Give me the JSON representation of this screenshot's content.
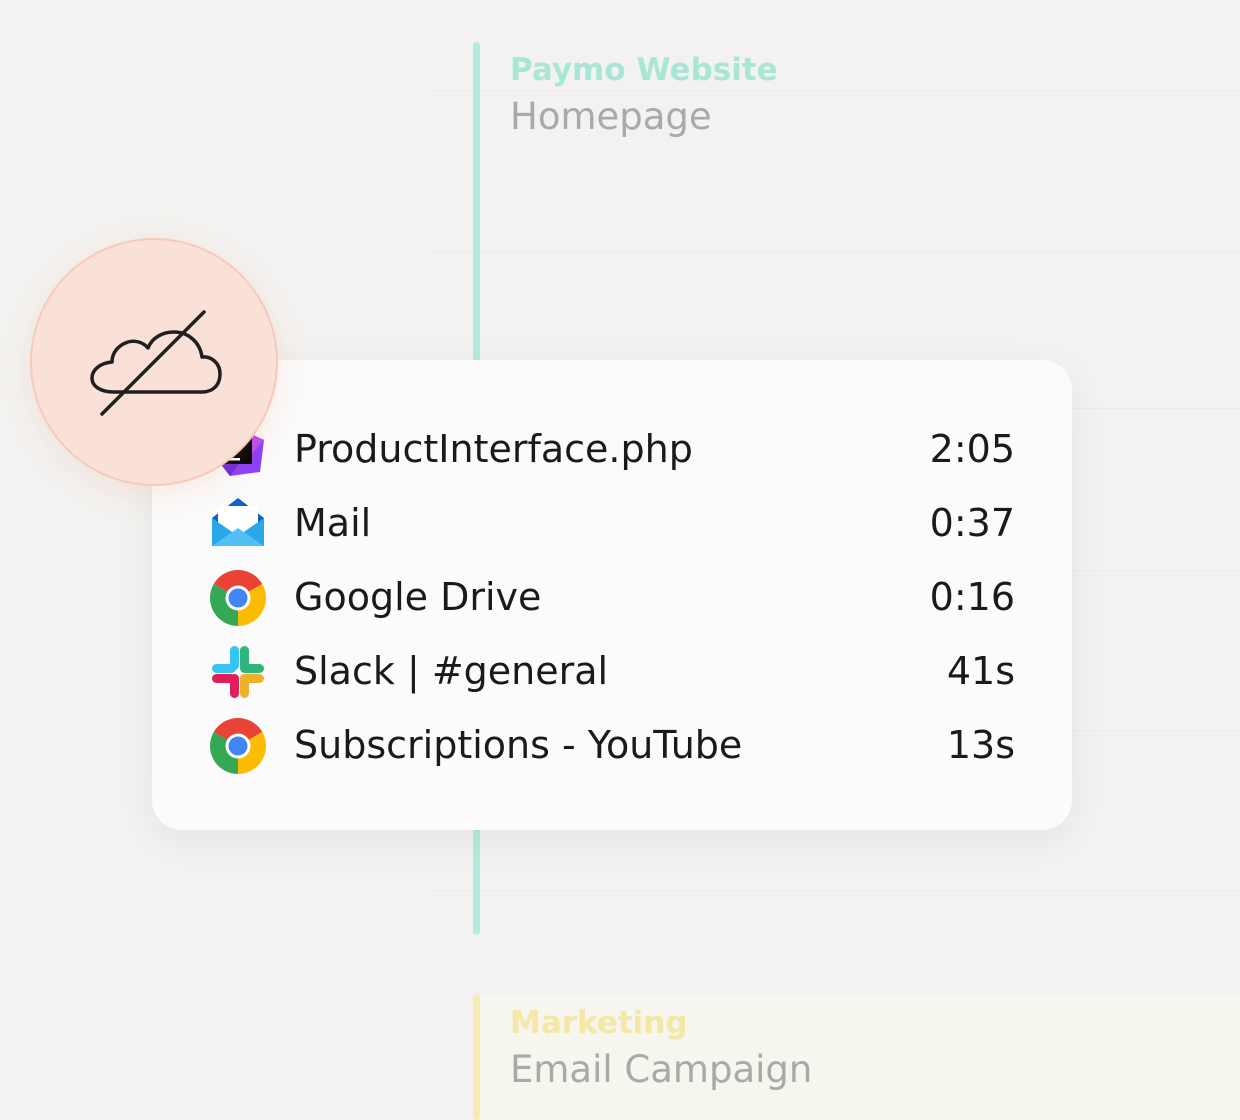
{
  "background_tasks": [
    {
      "project": "Paymo Website",
      "task": "Homepage",
      "color": "#b5ebdc",
      "project_color": "#a8e6d6"
    },
    {
      "project": "Marketing",
      "task": "Email Campaign",
      "color": "#f6ebb0",
      "project_color": "#f5e7a6"
    }
  ],
  "offline_indicator": {
    "icon": "cloud-off-icon"
  },
  "activity_list": {
    "items": [
      {
        "icon": "phpstorm-icon",
        "label": "ProductInterface.php",
        "duration": "2:05"
      },
      {
        "icon": "mail-icon",
        "label": "Mail",
        "duration": "0:37"
      },
      {
        "icon": "chrome-icon",
        "label": "Google Drive",
        "duration": "0:16"
      },
      {
        "icon": "slack-icon",
        "label": "Slack | #general",
        "duration": "41s"
      },
      {
        "icon": "chrome-icon",
        "label": "Subscriptions - YouTube",
        "duration": "13s"
      }
    ]
  }
}
